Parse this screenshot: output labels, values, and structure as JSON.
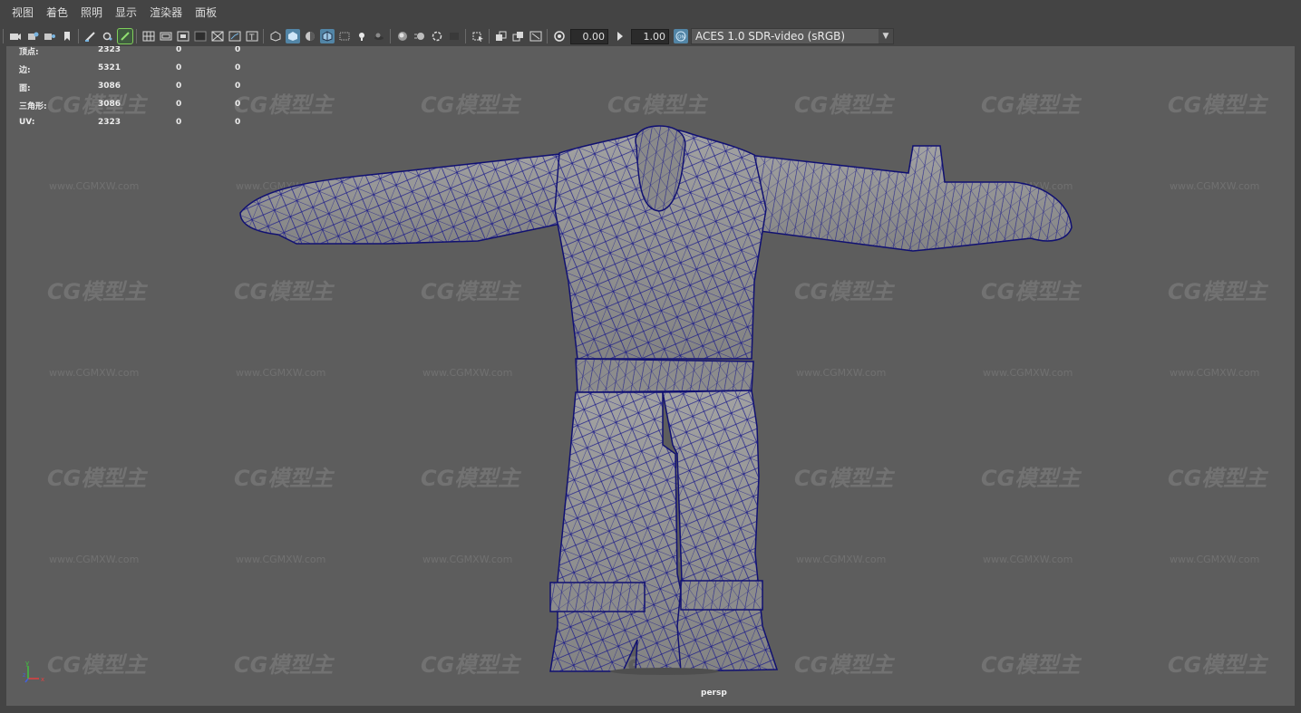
{
  "menu": [
    "视图",
    "着色",
    "照明",
    "显示",
    "渲染器",
    "面板"
  ],
  "toolbar": {
    "exposure_value": "0.00",
    "gamma_value": "1.00",
    "colorspace": "ACES 1.0 SDR-video (sRGB)",
    "icons": [
      "select-camera-icon",
      "camera-attributes-icon",
      "bookmark-icon",
      "image-plane-icon",
      "grease-pencil-icon",
      "2d-pan-zoom-icon",
      "grid-icon",
      "film-gate-icon",
      "resolution-gate-icon",
      "gate-mask-icon",
      "field-chart-icon",
      "safe-action-icon",
      "safe-title-icon",
      "wireframe-icon",
      "smooth-shade-icon",
      "default-material-icon",
      "wireframe-on-shaded-icon",
      "xray-icon",
      "use-lights-icon",
      "shadows-icon",
      "ambient-occlusion-icon",
      "motion-blur-icon",
      "anti-alias-icon",
      "depth-of-field-icon",
      "isolate-select-icon",
      "xray-joints-icon",
      "xray-active-icon",
      "toggle-hud-icon",
      "exposure-icon",
      "gamma-icon",
      "color-management-icon"
    ]
  },
  "hud": {
    "rows": [
      {
        "label": "顶点:",
        "v1": "2323",
        "v2": "0",
        "v3": "0"
      },
      {
        "label": "边:",
        "v1": "5321",
        "v2": "0",
        "v3": "0"
      },
      {
        "label": "面:",
        "v1": "3086",
        "v2": "0",
        "v3": "0"
      },
      {
        "label": "三角形:",
        "v1": "3086",
        "v2": "0",
        "v3": "0"
      },
      {
        "label": "UV:",
        "v1": "2323",
        "v2": "0",
        "v3": "0"
      }
    ]
  },
  "viewport": {
    "camera": "persp",
    "background": "#5d5d5d",
    "wire_color": "#1a1a8a",
    "mesh_color": "#8e8e8e"
  },
  "watermark": {
    "logo": "CG模型主",
    "url": "www.CGMXW.com"
  },
  "axis": {
    "x": "x",
    "y": "y",
    "z": "z"
  }
}
